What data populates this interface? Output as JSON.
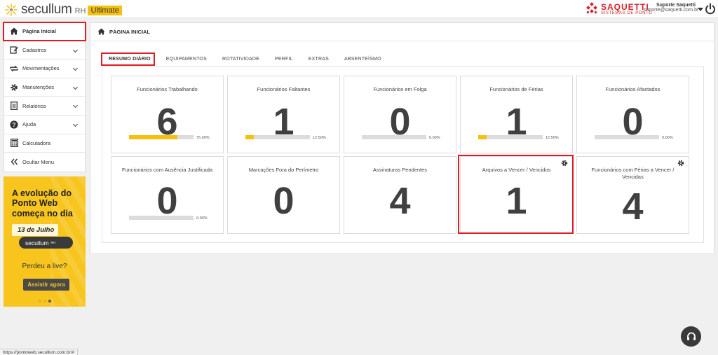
{
  "header": {
    "logo_text": "secullum",
    "logo_rh": "RH",
    "logo_badge": "Ultimate",
    "partner_name": "SAQUETTI",
    "partner_sub": "SISTEMAS DE PONTO",
    "user_name": "Suporte Saquetti",
    "user_email": "suporte@saquetti.com.br",
    "brand_color": "#f5c00e",
    "partner_color": "#d2232a"
  },
  "sidebar": {
    "items": [
      {
        "label": "Página Inicial",
        "icon": "home-icon",
        "active": true,
        "expandable": false
      },
      {
        "label": "Cadastros",
        "icon": "edit-icon",
        "active": false,
        "expandable": true
      },
      {
        "label": "Movimentações",
        "icon": "swap-icon",
        "active": false,
        "expandable": true
      },
      {
        "label": "Manutenções",
        "icon": "gear-icon",
        "active": false,
        "expandable": true
      },
      {
        "label": "Relatórios",
        "icon": "report-icon",
        "active": false,
        "expandable": true
      },
      {
        "label": "Ajuda",
        "icon": "question-icon",
        "active": false,
        "expandable": true
      },
      {
        "label": "Calculadora",
        "icon": "calculator-icon",
        "active": false,
        "expandable": false
      },
      {
        "label": "Ocultar Menu",
        "icon": "double-chevron-left-icon",
        "active": false,
        "expandable": false
      }
    ]
  },
  "banner": {
    "title": "A evolução do Ponto Web começa no dia",
    "date": "13 de Julho",
    "pill_text": "secullum",
    "pill_small": "RH",
    "subtitle": "Perdeu a live?",
    "button": "Assistir agora"
  },
  "page": {
    "title": "PÁGINA INICIAL",
    "tabs": [
      "RESUMO DIÁRIO",
      "EQUIPAMENTOS",
      "ROTATIVIDADE",
      "PERFIL",
      "EXTRAS",
      "ABSENTEÍSMO"
    ]
  },
  "cards": [
    {
      "title": "Funcionários Trabalhando",
      "value": "6",
      "percent_label": "75.00%",
      "percent": 75,
      "has_bar": true,
      "has_gear": false
    },
    {
      "title": "Funcionários Faltantes",
      "value": "1",
      "percent_label": "12.50%",
      "percent": 12.5,
      "has_bar": true,
      "has_gear": false
    },
    {
      "title": "Funcionários em Folga",
      "value": "0",
      "percent_label": "0.00%",
      "percent": 0,
      "has_bar": true,
      "has_gear": false
    },
    {
      "title": "Funcionários de Férias",
      "value": "1",
      "percent_label": "12.50%",
      "percent": 12.5,
      "has_bar": true,
      "has_gear": false
    },
    {
      "title": "Funcionários Afastados",
      "value": "0",
      "percent_label": "0.00%",
      "percent": 0,
      "has_bar": true,
      "has_gear": false
    },
    {
      "title": "Funcionários com Ausência Justificada",
      "value": "0",
      "percent_label": "0.00%",
      "percent": 0,
      "has_bar": true,
      "has_gear": false
    },
    {
      "title": "Marcações Fora do Perímetro",
      "value": "0",
      "has_bar": false,
      "has_gear": false
    },
    {
      "title": "Assinaturas Pendentes",
      "value": "4",
      "has_bar": false,
      "has_gear": false
    },
    {
      "title": "Arquivos a Vencer / Vencidos",
      "value": "1",
      "has_bar": false,
      "has_gear": true
    },
    {
      "title": "Funcionários com Férias a Vencer / Vencidas",
      "value": "4",
      "has_bar": false,
      "has_gear": true
    }
  ],
  "status_url": "https://pontoweb.secullum.com.br/#"
}
